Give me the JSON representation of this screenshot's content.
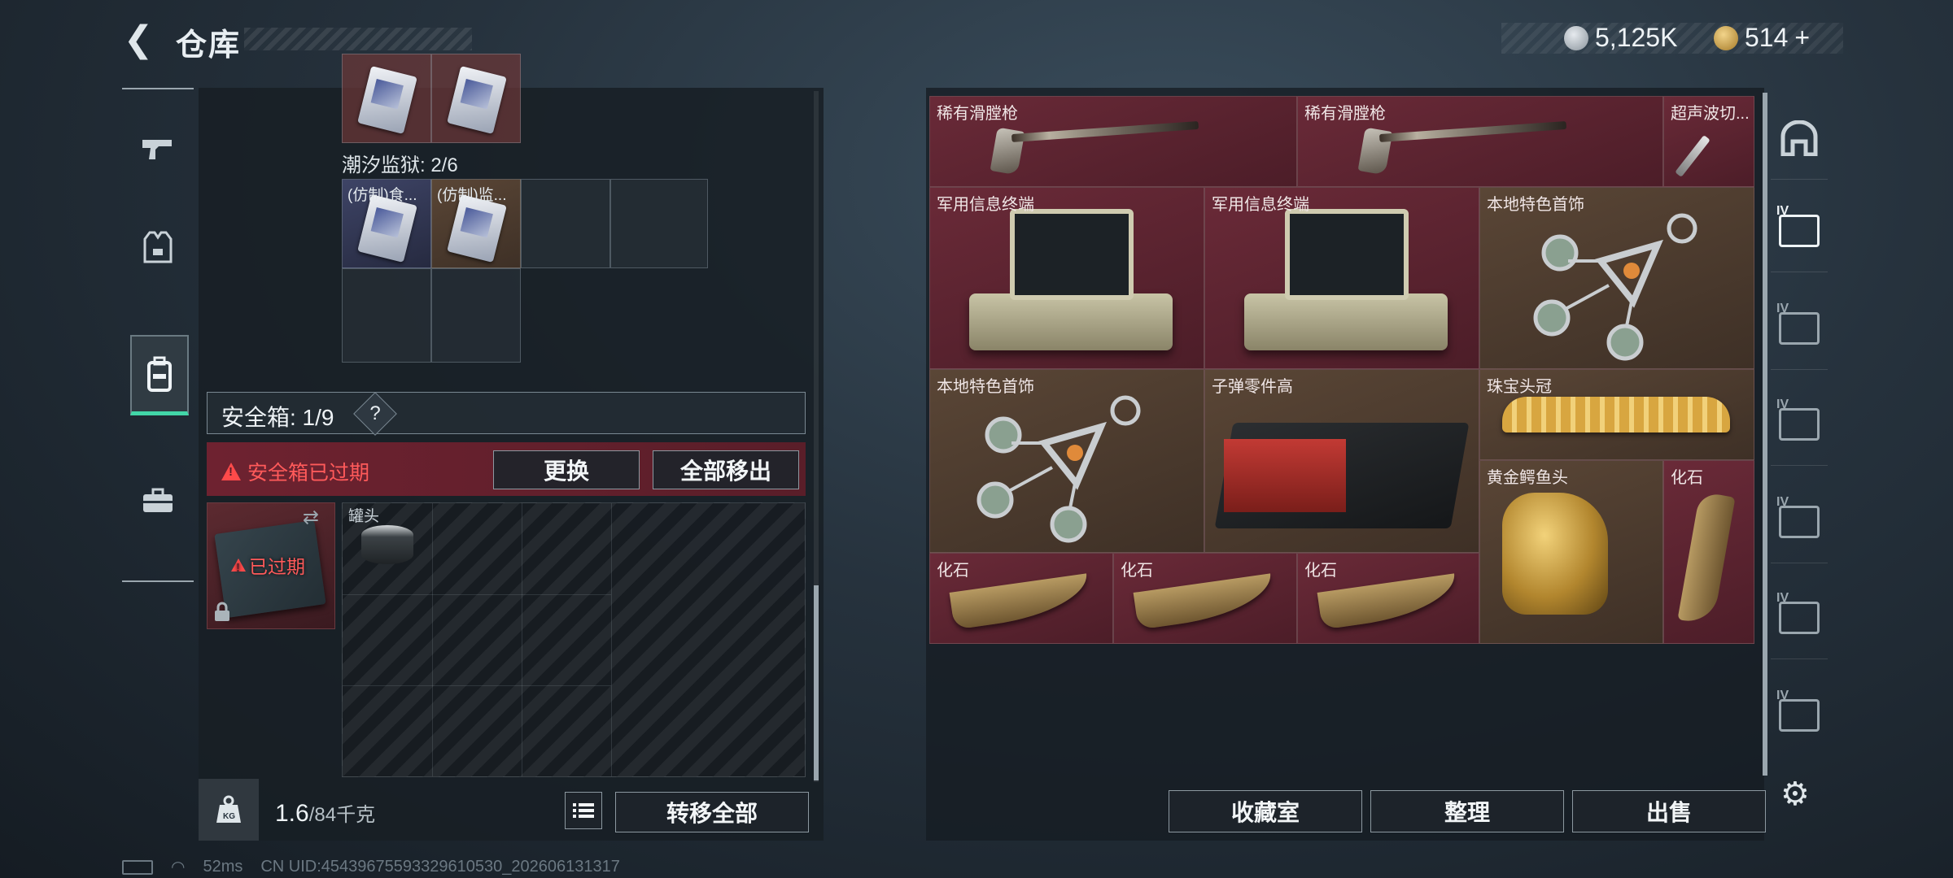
{
  "header": {
    "title": "仓库",
    "currency_silver": "5,125K",
    "currency_gold": "514",
    "add_symbol": "+"
  },
  "left_panel": {
    "container_items": [
      {
        "label": "(仿制)食..."
      },
      {
        "label": "(仿制)监..."
      }
    ],
    "tide_prison_label": "潮汐监狱: 2/6",
    "safe_box": {
      "label": "安全箱: 1/9",
      "help": "?",
      "expired_message": "安全箱已过期",
      "replace_button": "更换",
      "remove_all_button": "全部移出",
      "item_status": "已过期",
      "can_label": "罐头"
    },
    "weight": {
      "current": "1.6",
      "max": "/84千克",
      "icon_text": "KG"
    },
    "transfer_all_button": "转移全部"
  },
  "stash": {
    "items": [
      {
        "label": "稀有滑膛枪"
      },
      {
        "label": "稀有滑膛枪"
      },
      {
        "label": "超声波切..."
      },
      {
        "label": "军用信息终端"
      },
      {
        "label": "军用信息终端"
      },
      {
        "label": "本地特色首饰"
      },
      {
        "label": "本地特色首饰"
      },
      {
        "label": "子弹零件高"
      },
      {
        "label": "珠宝头冠"
      },
      {
        "label": "黄金鳄鱼头"
      },
      {
        "label": "化石"
      },
      {
        "label": "化石"
      },
      {
        "label": "化石"
      },
      {
        "label": "化石"
      }
    ],
    "collection_button": "收藏室",
    "organize_button": "整理",
    "sell_button": "出售"
  },
  "right_rail": {
    "tier_label": "IV"
  },
  "status_bar": {
    "ping": "52ms",
    "uid": "CN UID:4543967559332961053​0_202606131317"
  },
  "colors": {
    "accent": "#42d6a8",
    "warning": "#ff4a4a",
    "slot_red": "#6a2a38",
    "slot_brown": "#5a4636"
  },
  "icons": {
    "back": "back-arrow-icon",
    "weapon": "pistol-icon",
    "armor": "vest-icon",
    "backpack": "backpack-icon",
    "briefcase": "briefcase-icon",
    "settings": "gear-icon"
  }
}
